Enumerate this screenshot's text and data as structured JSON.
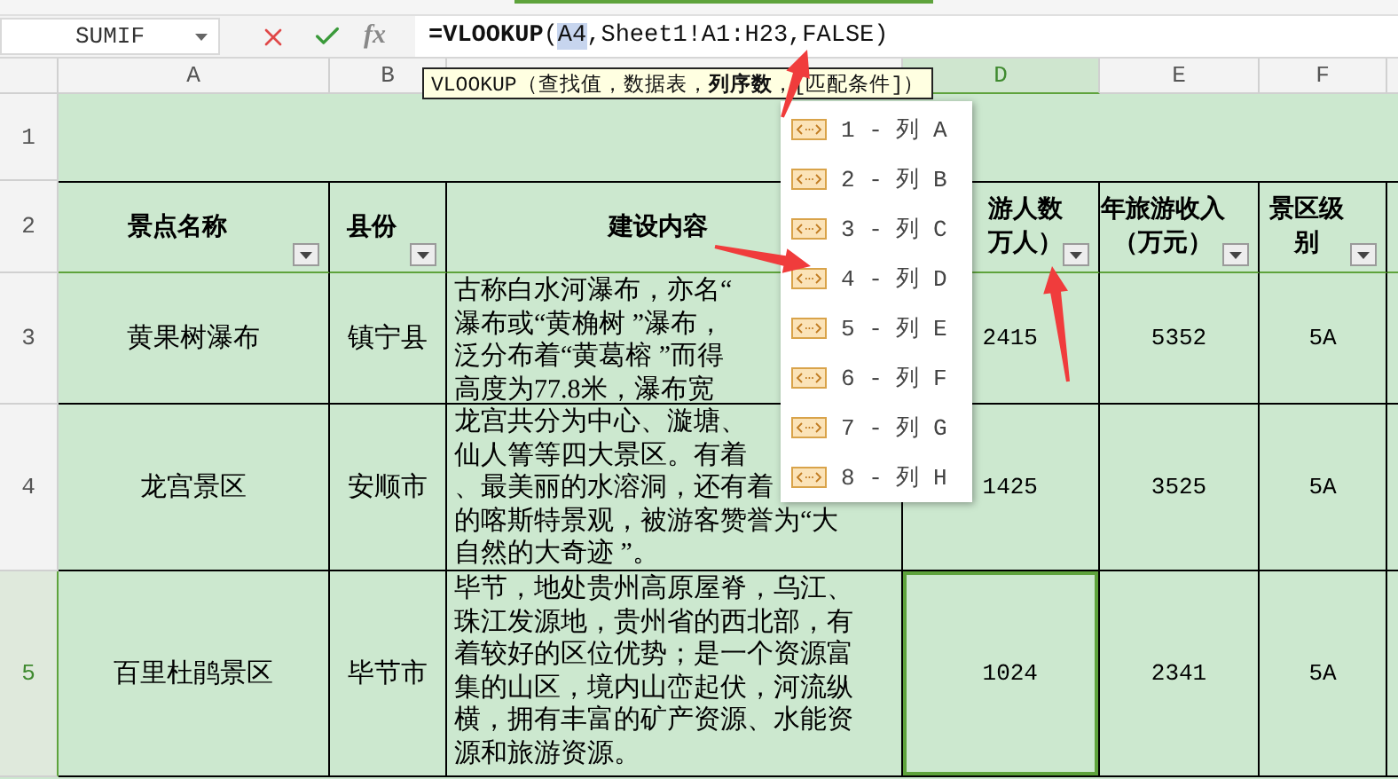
{
  "formula_bar": {
    "name_box": "SUMIF",
    "fx": "fx",
    "formula": [
      {
        "text": "=VLOOKUP",
        "kind": "function"
      },
      {
        "text": "(",
        "kind": "plain"
      },
      {
        "text": "A4",
        "kind": "reference"
      },
      {
        "text": ",Sheet1!A1:H23,FALSE)",
        "kind": "plain"
      }
    ]
  },
  "columns": [
    {
      "letter": "A",
      "selected": false
    },
    {
      "letter": "B",
      "selected": false
    },
    {
      "selected": false
    },
    {
      "letter": "D",
      "selected": true
    },
    {
      "letter": "E",
      "selected": false
    },
    {
      "letter": "F",
      "selected": false
    }
  ],
  "header_row": {
    "number": "2",
    "selected": false,
    "cells": [
      {
        "lines": [
          "景点名称"
        ],
        "filter": true
      },
      {
        "lines": [
          "县份"
        ],
        "filter": true
      },
      {
        "lines": [
          "建设内容"
        ]
      },
      {
        "lines": [
          "游人数",
          "万人）"
        ],
        "filter": true
      },
      {
        "lines": [
          "年旅游收入",
          "（万元）"
        ],
        "filter": true
      },
      {
        "lines": [
          "景区级",
          "别"
        ],
        "filter": true
      }
    ]
  },
  "rows": [
    {
      "number": "1",
      "selected": false
    },
    {
      "number": "3",
      "selected": false,
      "cells": [
        "黄果树瀑布",
        "镇宁县",
        [
          "古称白水河瀑布，亦名“",
          "瀑布或“黄桷树 ”瀑布，",
          "泛分布着“黄葛榕 ”而得",
          "高度为77.8米，瀑布宽"
        ],
        "2415",
        "5352",
        "5A"
      ]
    },
    {
      "number": "4",
      "selected": false,
      "cells": [
        "龙宫景区",
        "安顺市",
        [
          "龙宫共分为中心、漩塘、",
          "仙人箐等四大景区。有着",
          "、最美丽的水溶洞，还有着",
          "的喀斯特景观，被游客赞誉为“大",
          "自然的大奇迹 ”。"
        ],
        "1425",
        "3525",
        "5A"
      ]
    },
    {
      "number": "5",
      "selected": true,
      "cells": [
        "百里杜鹃景区",
        "毕节市",
        [
          "毕节，地处贵州高原屋脊，乌江、",
          "珠江发源地，贵州省的西北部，有",
          "着较好的区位优势；是一个资源富",
          "集的山区，境内山峦起伏，河流纵",
          "横，拥有丰富的矿产资源、水能资",
          "源和旅游资源。"
        ],
        "1024",
        "2341",
        "5A"
      ]
    }
  ],
  "tooltip": "VLOOKUP（查找值，数据表，**列序数**，[匹配条件]）",
  "menu": [
    "1 - 列 A",
    "2 - 列 B",
    "3 - 列 C",
    "4 - 列 D",
    "5 - 列 E",
    "6 - 列 F",
    "7 - 列 G",
    "8 - 列 H"
  ]
}
